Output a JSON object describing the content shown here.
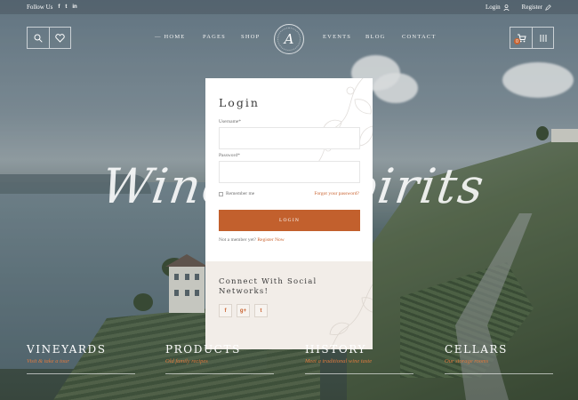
{
  "topbar": {
    "follow_label": "Follow Us",
    "social": [
      "f",
      "t",
      "in"
    ],
    "login_label": "Login",
    "register_label": "Register"
  },
  "nav": {
    "items": [
      "Home",
      "Pages",
      "Shop",
      "Events",
      "Blog",
      "Contact"
    ],
    "logo_letter": "A",
    "cart_count": "0"
  },
  "hero": {
    "script_text": "Wine & Spirits"
  },
  "login": {
    "title": "Login",
    "username_label": "Username*",
    "username_value": "",
    "password_label": "Password*",
    "password_value": "",
    "remember_label": "Remember me",
    "forgot_label": "Forgot your password?",
    "submit_label": "Login",
    "not_member_text": "Not a member yet?",
    "register_link": "Register Now",
    "connect_title": "Connect With Social Networks!",
    "social_buttons": [
      "f",
      "g+",
      "t"
    ]
  },
  "sections": [
    {
      "title": "Vineyards",
      "subtitle": "Visit & take a tour"
    },
    {
      "title": "Products",
      "subtitle": "Old family recipes"
    },
    {
      "title": "History",
      "subtitle": "Meet a traditional wine taste"
    },
    {
      "title": "Cellars",
      "subtitle": "Our storage rooms"
    }
  ],
  "colors": {
    "accent": "#c2602d",
    "link": "#c9622f",
    "panel_bottom": "#f2ede8"
  },
  "icons": {
    "search": "search-icon",
    "wishlist": "heart-icon",
    "cart": "cart-icon",
    "menu": "menu-icon",
    "user": "user-icon",
    "pen": "pen-icon"
  }
}
